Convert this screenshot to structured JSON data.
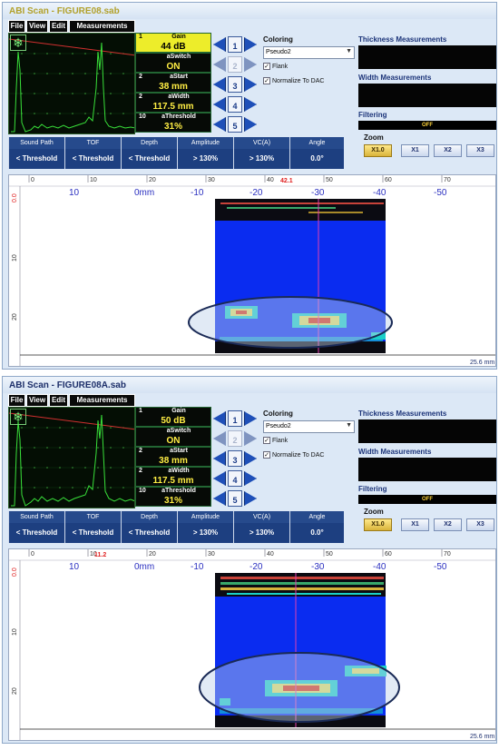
{
  "panels": [
    {
      "title": "ABI Scan - FIGURE08.sab",
      "menu": [
        "File",
        "View",
        "Edit",
        "Measurements"
      ],
      "params": [
        {
          "num": "1",
          "name": "Gain",
          "value": "44 dB",
          "selected": true
        },
        {
          "num": "",
          "name": "aSwitch",
          "value": "ON"
        },
        {
          "num": "2",
          "name": "aStart",
          "value": "38 mm"
        },
        {
          "num": "2",
          "name": "aWidth",
          "value": "117.5 mm"
        },
        {
          "num": "10",
          "name": "aThreshold",
          "value": "31%"
        }
      ],
      "arrow_numbers": [
        "1",
        "2",
        "3",
        "4",
        "5"
      ],
      "coloring_label": "Coloring",
      "coloring_value": "Pseudo2",
      "flank_label": "Flank",
      "normalize_label": "Normalize To DAC",
      "thickness_label": "Thickness Measurements",
      "width_label": "Width Measurements",
      "filtering_label": "Filtering",
      "filtering_value": "OFF",
      "zoom_label": "Zoom",
      "zoom_buttons": [
        "X1.0",
        "X1",
        "X2",
        "X3"
      ],
      "readout": [
        {
          "head": "Sound Path",
          "val": "< Threshold"
        },
        {
          "head": "TOF",
          "val": "< Threshold"
        },
        {
          "head": "Depth",
          "val": "< Threshold"
        },
        {
          "head": "Amplitude",
          "val": "> 130%"
        },
        {
          "head": "VC(A)",
          "val": "> 130%"
        },
        {
          "head": "Angle",
          "val": "0.0°"
        }
      ],
      "ruler_ticks": [
        "0",
        "10",
        "20",
        "30",
        "40",
        "50",
        "60",
        "70"
      ],
      "cursor_value": "42.1",
      "scale_labels": [
        "10",
        "0mm",
        "-10",
        "-20",
        "-30",
        "-40",
        "-50"
      ],
      "depth_labels": [
        "0.0",
        "10",
        "20"
      ],
      "range_label": "25.6 mm"
    },
    {
      "title": "ABI Scan - FIGURE08A.sab",
      "menu": [
        "File",
        "View",
        "Edit",
        "Measurements"
      ],
      "params": [
        {
          "num": "1",
          "name": "Gain",
          "value": "50 dB"
        },
        {
          "num": "",
          "name": "aSwitch",
          "value": "ON"
        },
        {
          "num": "2",
          "name": "aStart",
          "value": "38 mm"
        },
        {
          "num": "2",
          "name": "aWidth",
          "value": "117.5 mm"
        },
        {
          "num": "10",
          "name": "aThreshold",
          "value": "31%"
        }
      ],
      "arrow_numbers": [
        "1",
        "2",
        "3",
        "4",
        "5"
      ],
      "coloring_label": "Coloring",
      "coloring_value": "Pseudo2",
      "flank_label": "Flank",
      "normalize_label": "Normalize To DAC",
      "thickness_label": "Thickness Measurements",
      "width_label": "Width Measurements",
      "filtering_label": "Filtering",
      "filtering_value": "OFF",
      "zoom_label": "Zoom",
      "zoom_buttons": [
        "X1.0",
        "X1",
        "X2",
        "X3"
      ],
      "readout": [
        {
          "head": "Sound Path",
          "val": "< Threshold"
        },
        {
          "head": "TOF",
          "val": "< Threshold"
        },
        {
          "head": "Depth",
          "val": "< Threshold"
        },
        {
          "head": "Amplitude",
          "val": "> 130%"
        },
        {
          "head": "VC(A)",
          "val": "> 130%"
        },
        {
          "head": "Angle",
          "val": "0.0°"
        }
      ],
      "ruler_ticks": [
        "0",
        "10",
        "20",
        "30",
        "40",
        "50",
        "60",
        "70"
      ],
      "cursor_value": "11.2",
      "scale_labels": [
        "10",
        "0mm",
        "-10",
        "-20",
        "-30",
        "-40",
        "-50"
      ],
      "depth_labels": [
        "0.0",
        "10",
        "20"
      ],
      "range_label": "25.6 mm"
    }
  ],
  "colors": {
    "bscan_blue": "#0a2cf0",
    "gate_yellow": "#eded2a",
    "readout_blue": "#1d3f80"
  }
}
